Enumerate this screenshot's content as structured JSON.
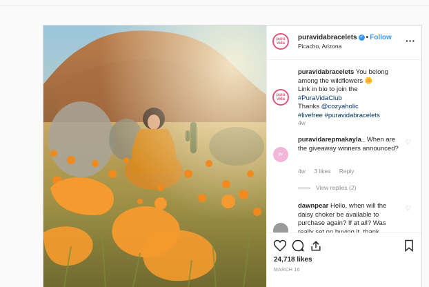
{
  "header": {
    "username": "puravidabracelets",
    "follow_label": "Follow",
    "location": "Picacho, Arizona",
    "avatar_text": "pura vida"
  },
  "caption": {
    "username": "puravidabracelets",
    "text_1": "You belong among the wildflowers",
    "emoji": "🌼",
    "text_2": "Link in bio to join the",
    "tag_club": "#PuraVidaClub",
    "thanks": "Thanks",
    "mention": "@cozyaholic",
    "tag_live": "#livefree",
    "tag_brand": "#puravidabracelets",
    "time": "4w"
  },
  "comments": [
    {
      "username": "puravidarepmakayla_",
      "text": "When are the giveaway winners announced?",
      "time": "4w",
      "likes": "3 likes",
      "reply_label": "Reply",
      "view_replies": "View replies (2)",
      "avatar_text": "pv"
    },
    {
      "username": "dawnpear",
      "text": "Hello, when will the daisy choker be available to purchase again? If at all? Was really set on buying it, thank"
    }
  ],
  "actions": {
    "likes": "24,718 likes",
    "date": "MARCH 16"
  },
  "colors": {
    "accent": "#3897f0",
    "brand_pink": "#e35478",
    "poppy": "#f49a2e"
  }
}
